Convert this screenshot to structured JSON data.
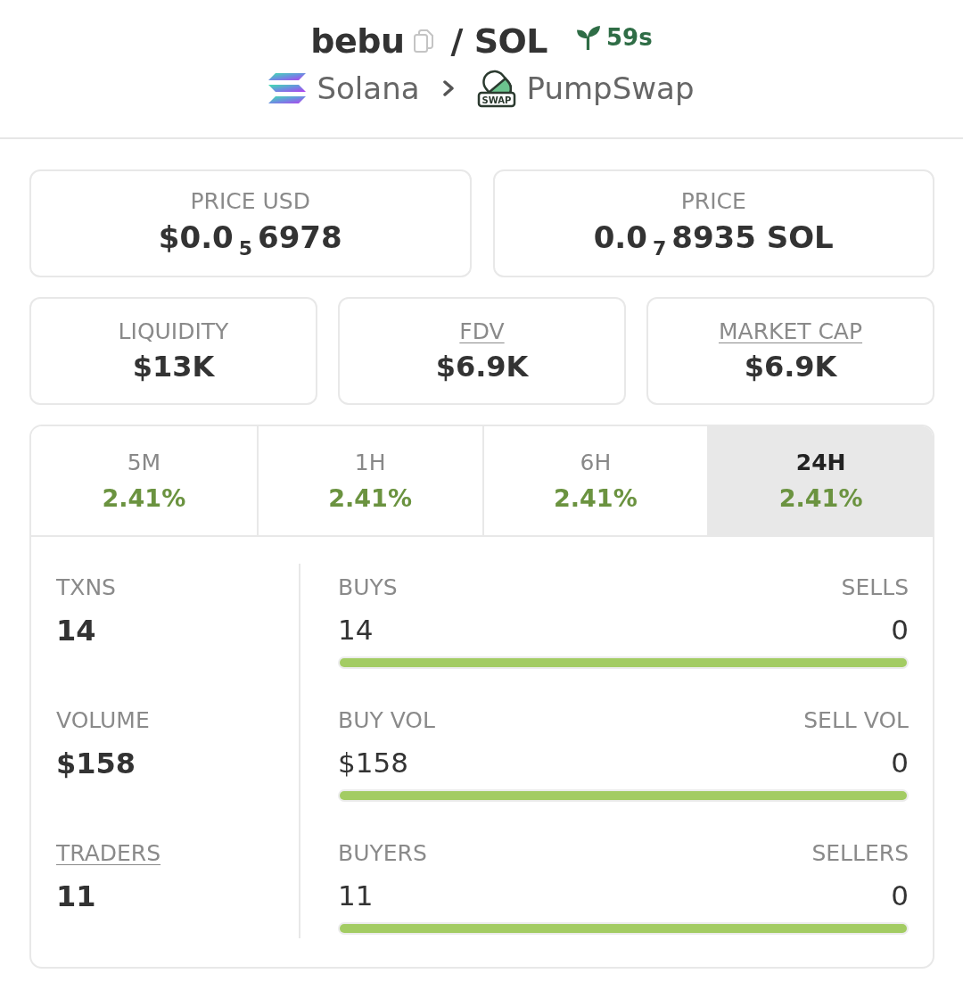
{
  "header": {
    "base_token": "bebu",
    "quote_token": "/ SOL",
    "age": "59s",
    "chain": "Solana",
    "dex_badge": "SWAP",
    "dex": "PumpSwap"
  },
  "prices": [
    {
      "label": "PRICE USD",
      "value": "$0.0$_{5}$6978"
    },
    {
      "label": "PRICE",
      "value": "0.0$_{7}$8935 SOL"
    }
  ],
  "stats": [
    {
      "label": "LIQUIDITY",
      "value": "$13K",
      "underlined": false
    },
    {
      "label": "FDV",
      "value": "$6.9K",
      "underlined": true
    },
    {
      "label": "MARKET CAP",
      "value": "$6.9K",
      "underlined": true
    }
  ],
  "timeframes": [
    {
      "label": "5M",
      "change": "2.41%",
      "selected": false
    },
    {
      "label": "1H",
      "change": "2.41%",
      "selected": false
    },
    {
      "label": "6H",
      "change": "2.41%",
      "selected": false
    },
    {
      "label": "24H",
      "change": "2.41%",
      "selected": true
    }
  ],
  "metrics": [
    {
      "label": "TXNS",
      "value": "14",
      "underlined": false,
      "left_label": "BUYS",
      "left_value": "14",
      "right_label": "SELLS",
      "right_value": "0",
      "level": 1
    },
    {
      "label": "VOLUME",
      "value": "$158",
      "underlined": false,
      "left_label": "BUY VOL",
      "left_value": "$158",
      "right_label": "SELL VOL",
      "right_value": "0",
      "level": 1
    },
    {
      "label": "TRADERS",
      "value": "11",
      "underlined": true,
      "left_label": "BUYERS",
      "left_value": "11",
      "right_label": "SELLERS",
      "right_value": "0",
      "level": 1
    }
  ]
}
